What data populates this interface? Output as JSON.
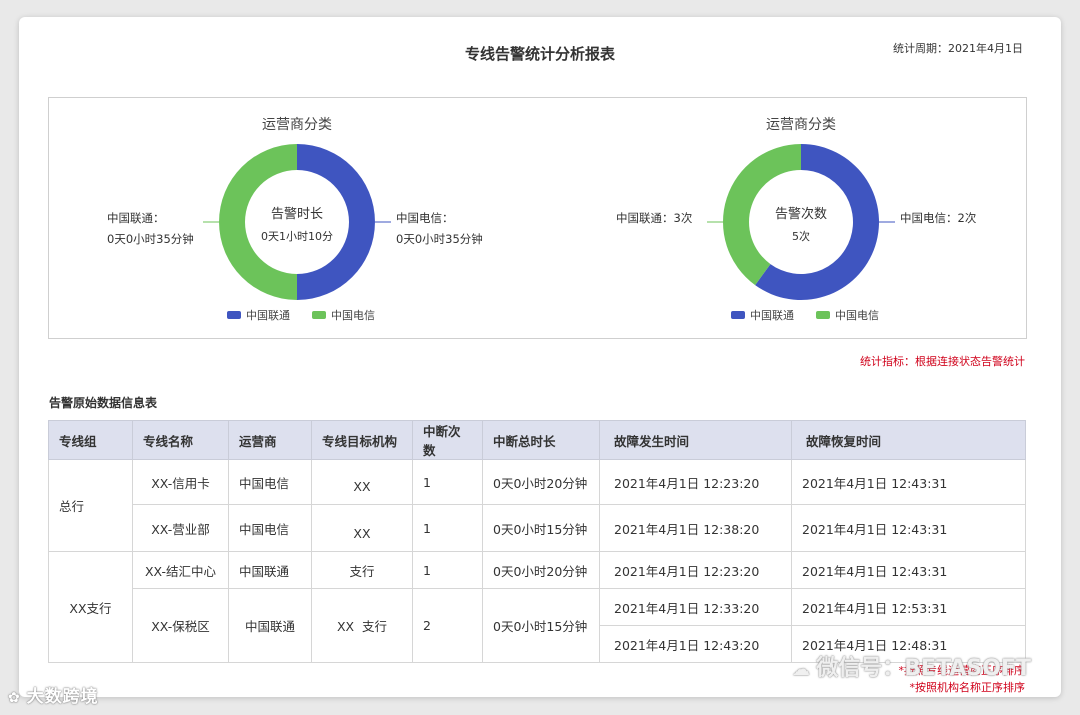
{
  "report": {
    "title": "专线告警统计分析报表",
    "period": "统计周期：2021年4月1日",
    "stat_note": "统计指标：根据连接状态告警统计",
    "table_title": "告警原始数据信息表",
    "footnote_1": "*按照专线运营商正序排序",
    "footnote_2": "*按照机构名称正序排序"
  },
  "chart_data": [
    {
      "type": "pie",
      "title": "运营商分类",
      "center_title": "告警时长",
      "center_value": "0天1小时10分",
      "categories": [
        "中国联通",
        "中国电信"
      ],
      "values": [
        35,
        35
      ],
      "labels": {
        "left_line1": "中国联通：",
        "left_line2": "0天0小时35分钟",
        "right_line1": "中国电信：",
        "right_line2": "0天0小时35分钟"
      },
      "colors": [
        "#3f55c0",
        "#6cc35a"
      ],
      "legend": [
        "中国联通",
        "中国电信"
      ],
      "legend_position": "bottom"
    },
    {
      "type": "pie",
      "title": "运营商分类",
      "center_title": "告警次数",
      "center_value": "5次",
      "categories": [
        "中国联通",
        "中国电信"
      ],
      "values": [
        3,
        2
      ],
      "labels": {
        "left_line1": "中国联通：3次",
        "right_line1": "中国电信：2次"
      },
      "colors": [
        "#3f55c0",
        "#6cc35a"
      ],
      "legend": [
        "中国联通",
        "中国电信"
      ],
      "legend_position": "bottom"
    }
  ],
  "table": {
    "headers": [
      "专线组",
      "专线名称",
      "运营商",
      "专线目标机构",
      "中断次数",
      "中断总时长",
      "故障发生时间",
      "故障恢复时间"
    ],
    "group_1": "总行",
    "group_2": "XX支行",
    "rows": [
      {
        "name": "XX-信用卡",
        "operator": "中国电信",
        "target": "XX",
        "count": "1",
        "duration": "0天0小时20分钟",
        "start": "2021年4月1日 12:23:20",
        "end": "2021年4月1日 12:43:31"
      },
      {
        "name": "XX-营业部",
        "operator": "中国电信",
        "target": "XX",
        "count": "1",
        "duration": "0天0小时15分钟",
        "start": "2021年4月1日 12:38:20",
        "end": "2021年4月1日 12:43:31"
      },
      {
        "name": "XX-结汇中心",
        "operator": "中国联通",
        "target": "支行",
        "count": "1",
        "duration": "0天0小时20分钟",
        "start": "2021年4月1日 12:23:20",
        "end": "2021年4月1日 12:43:31"
      },
      {
        "name": "XX-保税区",
        "operator": "中国联通",
        "target": "XX  支行",
        "count": "2",
        "duration": "0天0小时15分钟",
        "start": "2021年4月1日 12:33:20",
        "end": "2021年4月1日 12:53:31",
        "start2": "2021年4月1日 12:43:20",
        "end2": "2021年4月1日 12:48:31"
      }
    ]
  },
  "watermarks": {
    "left": "大数跨境",
    "right": "微信号：BETASOFT"
  }
}
